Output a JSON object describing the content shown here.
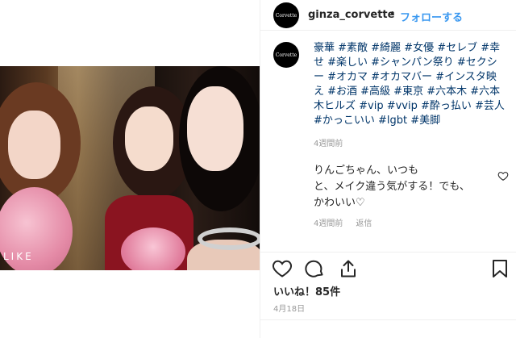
{
  "post": {
    "photo_overlay_text": "LIKE"
  },
  "header": {
    "avatar_text": "Corvette",
    "username": "ginza_corvette",
    "separator": "•",
    "follow_label": "フォローする"
  },
  "comments": {
    "avatar_text": "Corvette",
    "caption_lines": [
      "豪華 #素敵 #綺麗 #女優 #セレブ #幸",
      "せ #楽しい #シャンパン祭り #セクシ",
      "ー #オカマ #オカマバー #インスタ映",
      "え #お酒 #高級 #東京 #六本木 #六本",
      "木ヒルズ #vip #vvip #酔っ払い #芸人",
      "#かっこいい #lgbt #美脚"
    ],
    "caption_time": "4週間前",
    "reply_lines": [
      "りんごちゃん、いつも",
      "と、メイク違う気がする！でも、",
      "かわいい♡"
    ],
    "reply_time": "4週間前",
    "reply_link": "返信"
  },
  "actions": {
    "like_icon": "heart-icon",
    "comment_icon": "comment-icon",
    "share_icon": "share-icon",
    "save_icon": "bookmark-icon"
  },
  "likes_text": "いいね！85件",
  "date_text": "4月18日"
}
